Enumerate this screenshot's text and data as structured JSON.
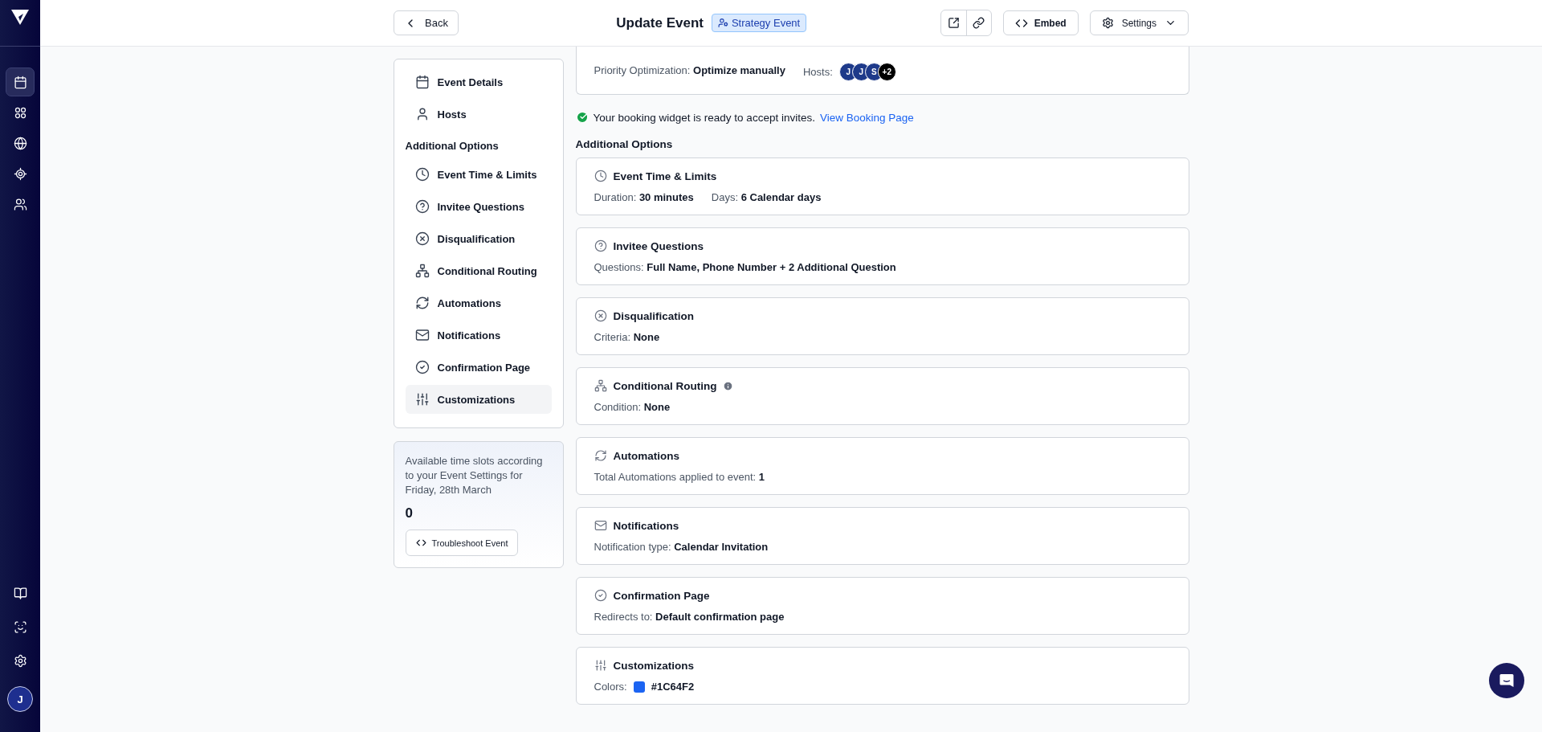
{
  "rail": {
    "items": [
      {
        "kind": "calendar",
        "selected": true
      },
      {
        "kind": "apps",
        "selected": false
      },
      {
        "kind": "globe",
        "selected": false
      },
      {
        "kind": "target",
        "selected": false
      },
      {
        "kind": "team",
        "selected": false
      }
    ],
    "bottom": [
      {
        "kind": "book"
      },
      {
        "kind": "scan"
      },
      {
        "kind": "settings"
      }
    ],
    "avatar": "J"
  },
  "header": {
    "back": "Back",
    "title": "Update Event",
    "badge": "Strategy Event",
    "embed": "Embed",
    "settings": "Settings"
  },
  "nav": {
    "items": [
      {
        "label": "Event Details",
        "kind": "calendar",
        "selected": false
      },
      {
        "label": "Hosts",
        "kind": "user",
        "selected": false
      }
    ],
    "section": "Additional Options",
    "options": [
      {
        "label": "Event Time & Limits",
        "kind": "clock",
        "selected": false
      },
      {
        "label": "Invitee Questions",
        "kind": "help",
        "selected": false
      },
      {
        "label": "Disqualification",
        "kind": "xcircle",
        "selected": false
      },
      {
        "label": "Conditional Routing",
        "kind": "routing",
        "selected": false
      },
      {
        "label": "Automations",
        "kind": "refresh",
        "selected": false
      },
      {
        "label": "Notifications",
        "kind": "mail",
        "selected": false
      },
      {
        "label": "Confirmation Page",
        "kind": "check",
        "selected": false
      },
      {
        "label": "Customizations",
        "kind": "sliders",
        "selected": true
      }
    ]
  },
  "slots": {
    "text": "Available time slots according to your Event Settings for Friday, 28th March",
    "count": "0",
    "button": "Troubleshoot Event"
  },
  "summary": {
    "priority_label": "Priority Optimization:",
    "priority_value": "Optimize manually",
    "hosts_label": "Hosts:",
    "hosts": [
      "J",
      "J",
      "S"
    ],
    "more": "+2"
  },
  "status": {
    "text": "Your booking widget is ready to accept invites.",
    "link": "View Booking Page"
  },
  "options_heading": "Additional Options",
  "cards": [
    {
      "title": "Event Time & Limits",
      "kind": "clock",
      "info": false,
      "fields": [
        {
          "label": "Duration:",
          "value": "30 minutes"
        },
        {
          "label": "Days:",
          "value": "6 Calendar days"
        }
      ]
    },
    {
      "title": "Invitee Questions",
      "kind": "help",
      "info": false,
      "fields": [
        {
          "label": "Questions:",
          "value": "Full Name, Phone Number + 2 Additional Question"
        }
      ]
    },
    {
      "title": "Disqualification",
      "kind": "xcircle",
      "info": false,
      "fields": [
        {
          "label": "Criteria:",
          "value": "None"
        }
      ]
    },
    {
      "title": "Conditional Routing",
      "kind": "routing",
      "info": true,
      "fields": [
        {
          "label": "Condition:",
          "value": "None"
        }
      ]
    },
    {
      "title": "Automations",
      "kind": "refresh",
      "info": false,
      "fields": [
        {
          "label": "Total Automations applied to event:",
          "value": "1"
        }
      ]
    },
    {
      "title": "Notifications",
      "kind": "mail",
      "info": false,
      "fields": [
        {
          "label": "Notification type:",
          "value": "Calendar Invitation"
        }
      ]
    },
    {
      "title": "Confirmation Page",
      "kind": "check",
      "info": false,
      "fields": [
        {
          "label": "Redirects to:",
          "value": "Default confirmation page"
        }
      ]
    },
    {
      "title": "Customizations",
      "kind": "sliders",
      "info": false,
      "fields": [
        {
          "label": "Colors:",
          "value": "#1C64F2",
          "color": "#1c64f2"
        }
      ]
    }
  ]
}
